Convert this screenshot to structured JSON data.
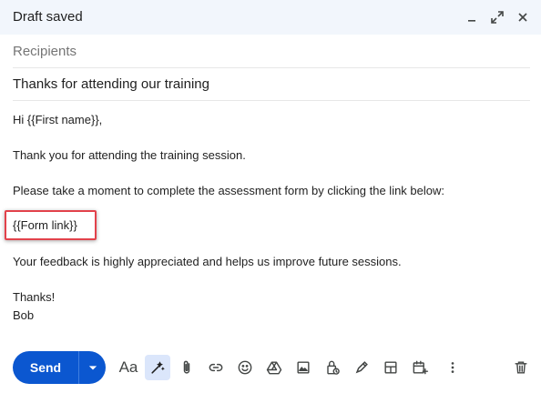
{
  "window": {
    "title": "Draft saved",
    "controls": [
      "minimize-icon",
      "expand-icon",
      "close-icon"
    ]
  },
  "recipients": {
    "label": "Recipients"
  },
  "subject": {
    "value": "Thanks for attending our training"
  },
  "body": {
    "greeting": "Hi {{First name}},",
    "line1": "Thank you for attending the training session.",
    "line2": "Please take a moment to complete the assessment form by clicking the link below:",
    "form_link": "{{Form link}}",
    "line3": "Your feedback is highly appreciated and helps us improve future sessions.",
    "closing": "Thanks!",
    "signature": "Bob"
  },
  "toolbar": {
    "send_label": "Send",
    "format_label": "Aa",
    "icons": [
      "formatting-options-icon",
      "help-me-write-icon",
      "attach-file-icon",
      "insert-link-icon",
      "insert-emoji-icon",
      "google-drive-icon",
      "insert-photo-icon",
      "confidential-mode-icon",
      "signature-icon",
      "layouts-icon",
      "schedule-meeting-icon",
      "more-options-icon",
      "discard-draft-icon"
    ]
  },
  "colors": {
    "accent": "#0b57d0",
    "header_bg": "#f2f6fc",
    "highlight_border": "#e2424b",
    "active_tool_bg": "#dbe6fb"
  }
}
